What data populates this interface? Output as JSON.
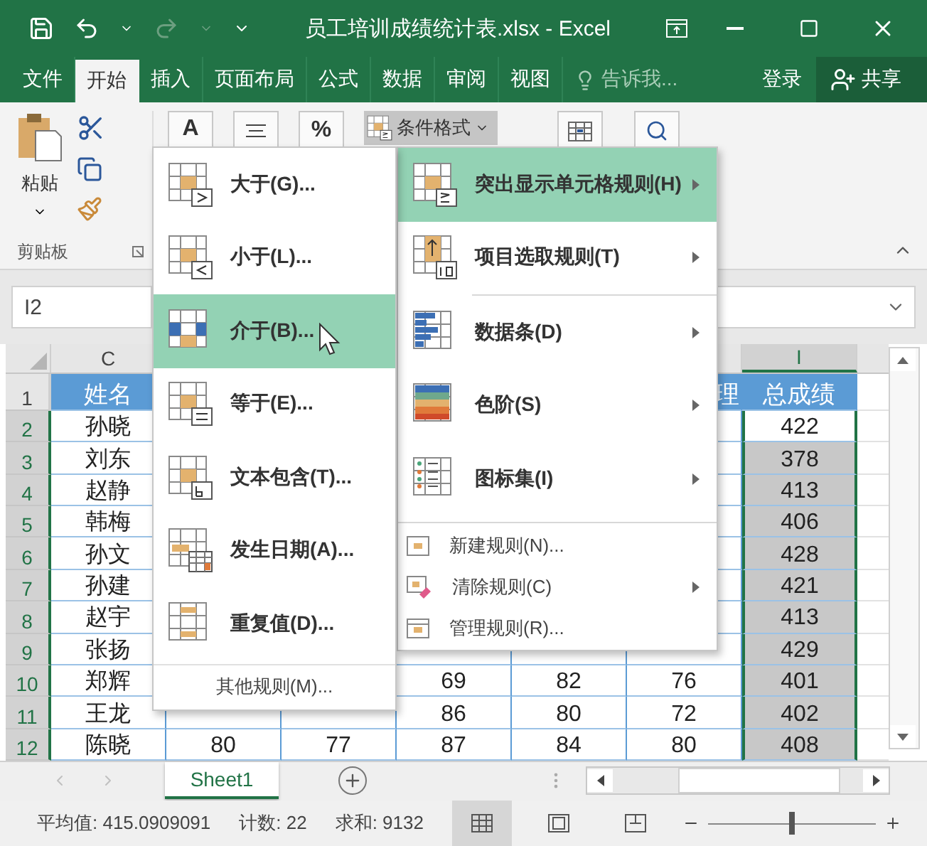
{
  "title_bar": {
    "title": "员工培训成绩统计表.xlsx - Excel",
    "redo_disabled": true
  },
  "tabs": [
    {
      "label": "文件",
      "kind": "tab",
      "selected": false
    },
    {
      "label": "开始",
      "kind": "tab",
      "selected": true
    },
    {
      "label": "插入",
      "kind": "tab",
      "selected": false
    },
    {
      "label": "页面布局",
      "kind": "tab",
      "selected": false
    },
    {
      "label": "公式",
      "kind": "tab",
      "selected": false
    },
    {
      "label": "数据",
      "kind": "tab",
      "selected": false
    },
    {
      "label": "审阅",
      "kind": "tab",
      "selected": false
    },
    {
      "label": "视图",
      "kind": "tab",
      "selected": false
    },
    {
      "label": "告诉我...",
      "kind": "search",
      "selected": false
    },
    {
      "label": "登录",
      "kind": "link",
      "selected": false
    },
    {
      "label": "共享",
      "kind": "share",
      "selected": false
    }
  ],
  "ribbon": {
    "paste_label": "粘贴",
    "group_label": "剪贴板",
    "font_glyph": "A",
    "percent_glyph": "%",
    "conditional_format": {
      "label": "条件格式",
      "pressed": true
    }
  },
  "name_box": "I2",
  "sheet": {
    "columns": [
      "C",
      null,
      null,
      null,
      null,
      null,
      "I"
    ],
    "rows": [
      {
        "number": "1",
        "kind": "header",
        "selected": false,
        "cells": [
          "姓名",
          null,
          null,
          null,
          null,
          {
            "text": "理",
            "partial": true
          },
          "总成绩"
        ]
      },
      {
        "number": "2",
        "kind": "data",
        "selected": true,
        "shaded": false,
        "cells": [
          "孙晓",
          null,
          null,
          null,
          null,
          null,
          "422"
        ]
      },
      {
        "number": "3",
        "kind": "data",
        "selected": true,
        "shaded": true,
        "cells": [
          "刘东",
          null,
          null,
          null,
          null,
          null,
          "378"
        ]
      },
      {
        "number": "4",
        "kind": "data",
        "selected": true,
        "shaded": true,
        "cells": [
          "赵静",
          null,
          null,
          null,
          null,
          null,
          "413"
        ]
      },
      {
        "number": "5",
        "kind": "data",
        "selected": true,
        "shaded": true,
        "cells": [
          "韩梅",
          null,
          null,
          null,
          null,
          null,
          "406"
        ]
      },
      {
        "number": "6",
        "kind": "data",
        "selected": true,
        "shaded": true,
        "cells": [
          "孙文",
          null,
          null,
          null,
          null,
          null,
          "428"
        ]
      },
      {
        "number": "7",
        "kind": "data",
        "selected": true,
        "shaded": true,
        "cells": [
          "孙建",
          null,
          null,
          null,
          null,
          null,
          "421"
        ]
      },
      {
        "number": "8",
        "kind": "data",
        "selected": true,
        "shaded": true,
        "cells": [
          "赵宇",
          null,
          null,
          null,
          null,
          null,
          "413"
        ]
      },
      {
        "number": "9",
        "kind": "data",
        "selected": true,
        "shaded": true,
        "cells": [
          "张扬",
          null,
          null,
          null,
          null,
          null,
          "429"
        ]
      },
      {
        "number": "10",
        "kind": "data",
        "selected": true,
        "shaded": true,
        "cells": [
          "郑辉",
          null,
          null,
          "69",
          "82",
          "76",
          "401"
        ]
      },
      {
        "number": "11",
        "kind": "data",
        "selected": true,
        "shaded": true,
        "cells": [
          "王龙",
          null,
          null,
          "86",
          "80",
          "72",
          "402"
        ]
      },
      {
        "number": "12",
        "kind": "data",
        "selected": true,
        "shaded": true,
        "cells": [
          "陈晓",
          "80",
          "77",
          "87",
          "84",
          "80",
          "408"
        ]
      }
    ]
  },
  "sheet_tabs": [
    {
      "label": "Sheet1",
      "selected": true
    }
  ],
  "status_bar": {
    "average": "平均值: 415.0909091",
    "count": "计数: 22",
    "sum": "求和: 9132",
    "views": [
      {
        "kind": "normal",
        "selected": true
      },
      {
        "kind": "page_layout",
        "selected": false
      },
      {
        "kind": "page_break",
        "selected": false
      }
    ],
    "zoom": {
      "level": 0.5
    }
  },
  "conditional_format_menu": {
    "items": [
      {
        "label": "突出显示单元格规则(H)",
        "kind": "highlight",
        "submenu": true,
        "selected": true,
        "separator": false
      },
      {
        "label": "项目选取规则(T)",
        "kind": "topbottom",
        "submenu": true,
        "selected": false,
        "separator": true
      },
      {
        "label": "数据条(D)",
        "kind": "databar",
        "submenu": true,
        "selected": false,
        "separator": false
      },
      {
        "label": "色阶(S)",
        "kind": "colorscale",
        "submenu": true,
        "selected": false,
        "separator": false
      },
      {
        "label": "图标集(I)",
        "kind": "iconset",
        "submenu": true,
        "selected": false,
        "separator": false
      },
      {
        "label": "新建规则(N)...",
        "kind": "new",
        "submenu": false,
        "selected": false,
        "separator": false
      },
      {
        "label": "清除规则(C)",
        "kind": "clear",
        "submenu": true,
        "selected": false,
        "separator": false
      },
      {
        "label": "管理规则(R)...",
        "kind": "manage",
        "submenu": false,
        "selected": false,
        "separator": false
      }
    ]
  },
  "highlight_rules_menu": {
    "items": [
      {
        "label": "大于(G)...",
        "kind": "greater",
        "selected": false
      },
      {
        "label": "小于(L)...",
        "kind": "less",
        "selected": false
      },
      {
        "label": "介于(B)...",
        "kind": "between",
        "selected": true
      },
      {
        "label": "等于(E)...",
        "kind": "equal",
        "selected": false
      },
      {
        "label": "文本包含(T)...",
        "kind": "text",
        "selected": false
      },
      {
        "label": "发生日期(A)...",
        "kind": "date",
        "selected": false
      },
      {
        "label": "重复值(D)...",
        "kind": "duplicate",
        "selected": false
      }
    ],
    "footer": "其他规则(M)..."
  }
}
